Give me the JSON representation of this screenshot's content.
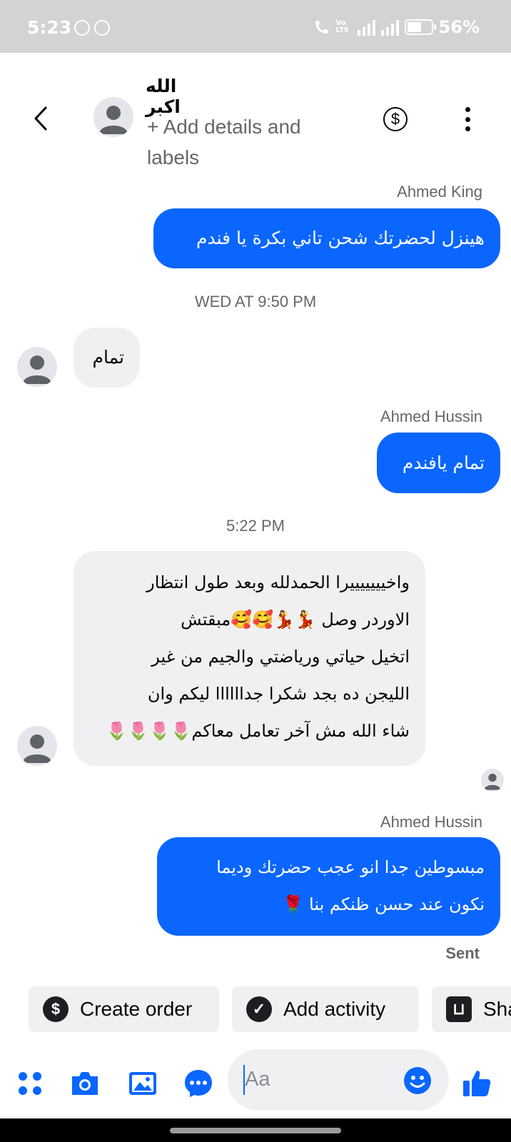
{
  "status_bar": {
    "time": "5:23",
    "network": "Vo LTE",
    "battery": "56%"
  },
  "header": {
    "contact_name": "الله اكبر",
    "add_details": "+ Add details and labels"
  },
  "messages": [
    {
      "type": "sender",
      "text": "Ahmed King"
    },
    {
      "type": "outgoing",
      "text": "هينزل لحضرتك شحن تاني بكرة يا فندم"
    },
    {
      "type": "timestamp",
      "text": "WED AT 9:50 PM"
    },
    {
      "type": "incoming",
      "text": "تمام"
    },
    {
      "type": "sender",
      "text": "Ahmed Hussin"
    },
    {
      "type": "outgoing",
      "text": "تمام يافندم"
    },
    {
      "type": "timestamp",
      "text": "5:22 PM"
    },
    {
      "type": "incoming",
      "lines": [
        "واخيييييييرا الحمدلله وبعد طول انتظار",
        "الاوردر وصل 💃💃🥰🥰مبقتش",
        "اتخيل حياتي ورياضتي والجيم من غير",
        "الليجن ده بجد شكرا جداااااا ليكم وان",
        "شاء الله مش آخر تعامل معاكم🌷🌷🌷🌷"
      ]
    },
    {
      "type": "sender",
      "text": "Ahmed Hussin"
    },
    {
      "type": "outgoing",
      "lines": [
        "مبسوطين جدا انو عجب حضرتك وديما",
        "نكون عند حسن ظنكم بنا 🌹"
      ]
    }
  ],
  "sent_status": "Sent",
  "quick_actions": [
    {
      "label": "Create order",
      "icon": "dollar-icon"
    },
    {
      "label": "Add activity",
      "icon": "check-icon"
    },
    {
      "label": "Share",
      "icon": "shop-icon"
    }
  ],
  "composer": {
    "placeholder": "Aa"
  },
  "colors": {
    "accent": "#0a66ff",
    "bubble_in": "#f0f0f2",
    "status_bar": "#d3d3d3"
  },
  "icons": {
    "composer": [
      "apps-icon",
      "camera-icon",
      "gallery-icon",
      "messenger-icon",
      "emoji-icon",
      "like-icon"
    ]
  }
}
